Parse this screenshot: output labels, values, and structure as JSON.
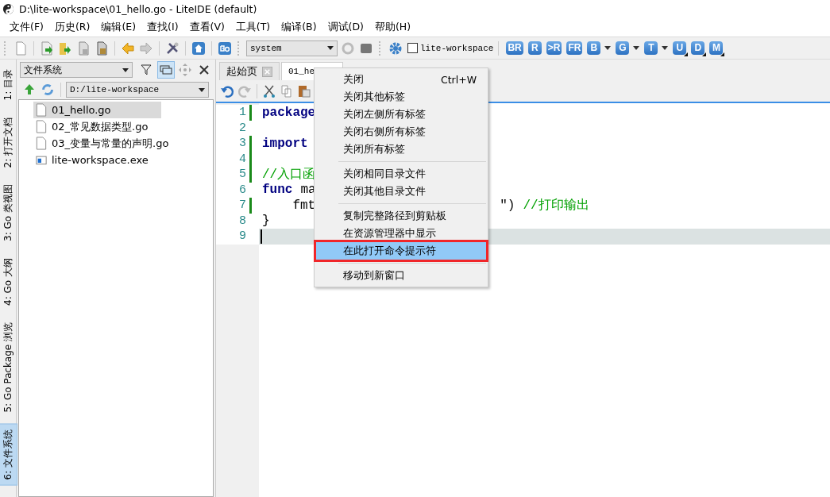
{
  "window": {
    "title": "D:\\lite-workspace\\01_hello.go - LiteIDE (default)"
  },
  "menu_bar": [
    "文件(F)",
    "历史(R)",
    "编辑(E)",
    "查找(I)",
    "查看(V)",
    "工具(T)",
    "编译(B)",
    "调试(D)",
    "帮助(H)"
  ],
  "toolbar": {
    "environment": "system",
    "project_checkbox": {
      "label": "lite-workspace",
      "checked": false
    },
    "build_buttons": [
      {
        "label": "BR",
        "kind": "plain"
      },
      {
        "label": "R",
        "kind": "plain"
      },
      {
        "label": ">R",
        "kind": "plain"
      },
      {
        "label": "FR",
        "kind": "plain"
      },
      {
        "label": "B",
        "kind": "dropdown"
      },
      {
        "label": "G",
        "kind": "dropdown"
      },
      {
        "label": "T",
        "kind": "dropdown"
      },
      {
        "label": "U",
        "kind": "corner"
      },
      {
        "label": "D",
        "kind": "corner"
      },
      {
        "label": "M",
        "kind": "corner"
      }
    ]
  },
  "side_tabs": [
    {
      "label": "1: 目录",
      "selected": false
    },
    {
      "label": "2: 打开文档",
      "selected": false
    },
    {
      "label": "3: Go 类视图",
      "selected": false
    },
    {
      "label": "4: Go 大纲",
      "selected": false
    },
    {
      "label": "5: Go Package 浏览",
      "selected": false
    },
    {
      "label": "6: 文件系统",
      "selected": true
    }
  ],
  "file_panel": {
    "view": "文件系统",
    "path": "D:/lite-workspace",
    "files": [
      {
        "name": "01_hello.go",
        "kind": "file",
        "selected": true
      },
      {
        "name": "02_常见数据类型.go",
        "kind": "file",
        "selected": false
      },
      {
        "name": "03_变量与常量的声明.go",
        "kind": "file",
        "selected": false
      },
      {
        "name": "lite-workspace.exe",
        "kind": "exe",
        "selected": false
      }
    ]
  },
  "editor_tabs": [
    {
      "label": "起始页",
      "selected": false
    },
    {
      "label": "01_he",
      "selected": true
    }
  ],
  "code_lines": [
    {
      "number": "1",
      "changed": true,
      "current": false,
      "segments": [
        {
          "text": "package",
          "kind": "keyword"
        }
      ]
    },
    {
      "number": "2",
      "changed": false,
      "current": false
    },
    {
      "number": "3",
      "changed": true,
      "current": false,
      "segments": [
        {
          "text": "import",
          "kind": "keyword"
        }
      ]
    },
    {
      "number": "4",
      "changed": true,
      "current": false
    },
    {
      "number": "5",
      "changed": true,
      "current": false,
      "segments": [
        {
          "text": "//入口函",
          "kind": "comment"
        }
      ]
    },
    {
      "number": "6",
      "changed": false,
      "current": false,
      "segments": [
        {
          "text": "func",
          "kind": "keyword"
        },
        {
          "text": "ma",
          "kind": "plain"
        }
      ]
    },
    {
      "number": "7",
      "changed": true,
      "current": false,
      "segments": [
        {
          "text": "    fmt",
          "kind": "plain"
        },
        {
          "text": "\")",
          "kind": "tail"
        },
        {
          "text": "//打印输出",
          "kind": "comment"
        }
      ]
    },
    {
      "number": "8",
      "changed": false,
      "current": false,
      "segments": [
        {
          "text": "}",
          "kind": "plain"
        }
      ]
    },
    {
      "number": "9",
      "changed": false,
      "current": true
    }
  ],
  "context_menu": {
    "groups": [
      [
        {
          "label": "关闭",
          "shortcut": "Ctrl+W",
          "selected": false,
          "outlined": false
        },
        {
          "label": "关闭其他标签",
          "selected": false,
          "outlined": false
        },
        {
          "label": "关闭左侧所有标签",
          "selected": false,
          "outlined": false
        },
        {
          "label": "关闭右侧所有标签",
          "selected": false,
          "outlined": false
        },
        {
          "label": "关闭所有标签",
          "selected": false,
          "outlined": false
        }
      ],
      [
        {
          "label": "关闭相同目录文件",
          "selected": false,
          "outlined": false
        },
        {
          "label": "关闭其他目录文件",
          "selected": false,
          "outlined": false
        }
      ],
      [
        {
          "label": "复制完整路径到剪贴板",
          "selected": false,
          "outlined": false
        },
        {
          "label": "在资源管理器中显示",
          "selected": false,
          "outlined": false
        },
        {
          "label": "在此打开命令提示符",
          "selected": true,
          "outlined": true
        }
      ],
      [
        {
          "label": "移动到新窗口",
          "selected": false,
          "outlined": false
        }
      ]
    ]
  }
}
